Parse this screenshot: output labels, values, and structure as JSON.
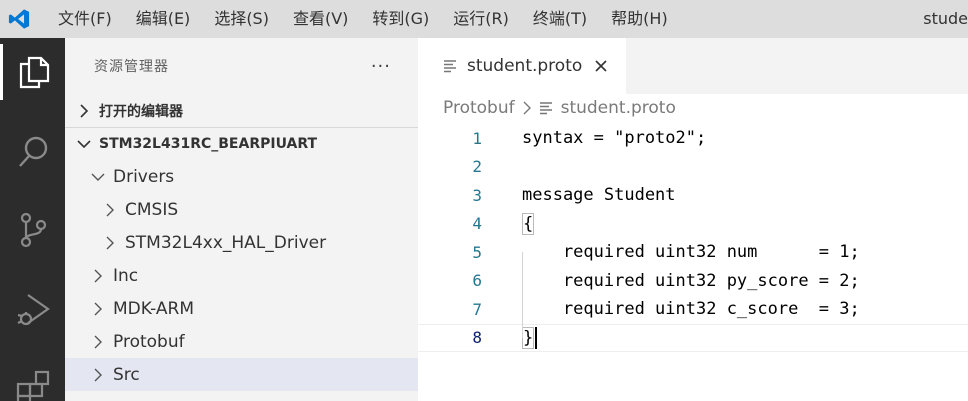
{
  "title_bar": {
    "menu": [
      "文件(F)",
      "编辑(E)",
      "选择(S)",
      "查看(V)",
      "转到(G)",
      "运行(R)",
      "终端(T)",
      "帮助(H)"
    ],
    "window_title": "stude"
  },
  "activity_bar": {
    "icons": [
      "files-icon",
      "search-icon",
      "source-control-icon",
      "run-debug-icon",
      "extensions-icon"
    ],
    "active": "files-icon"
  },
  "sidebar": {
    "title": "资源管理器",
    "more": "···",
    "open_editors": "打开的编辑器",
    "project": "STM32L431RC_BEARPIUART",
    "tree": [
      {
        "label": "Drivers",
        "expanded": true
      },
      {
        "label": "CMSIS",
        "expanded": false
      },
      {
        "label": "STM32L4xx_HAL_Driver",
        "expanded": false
      },
      {
        "label": "Inc",
        "expanded": false
      },
      {
        "label": "MDK-ARM",
        "expanded": false
      },
      {
        "label": "Protobuf",
        "expanded": false
      },
      {
        "label": "Src",
        "expanded": false,
        "selected": true
      }
    ]
  },
  "editor": {
    "tab": {
      "label": "student.proto"
    },
    "breadcrumb": {
      "folder": "Protobuf",
      "file": "student.proto"
    },
    "lines": [
      {
        "n": "1",
        "text": "syntax = \"proto2\";"
      },
      {
        "n": "2",
        "text": ""
      },
      {
        "n": "3",
        "text": "message Student"
      },
      {
        "n": "4",
        "text": "{"
      },
      {
        "n": "5",
        "text": "    required uint32 num      = 1;"
      },
      {
        "n": "6",
        "text": "    required uint32 py_score = 2;"
      },
      {
        "n": "7",
        "text": "    required uint32 c_score  = 3;"
      },
      {
        "n": "8",
        "text": "}"
      }
    ],
    "current_line": "8"
  },
  "colors": {
    "title_bar": "#dddddd",
    "activity_bar": "#2c2c2c",
    "sidebar": "#f3f3f3",
    "selection": "#e4e6f1",
    "line_number": "#237893",
    "vscode_blue": "#0078d4"
  }
}
